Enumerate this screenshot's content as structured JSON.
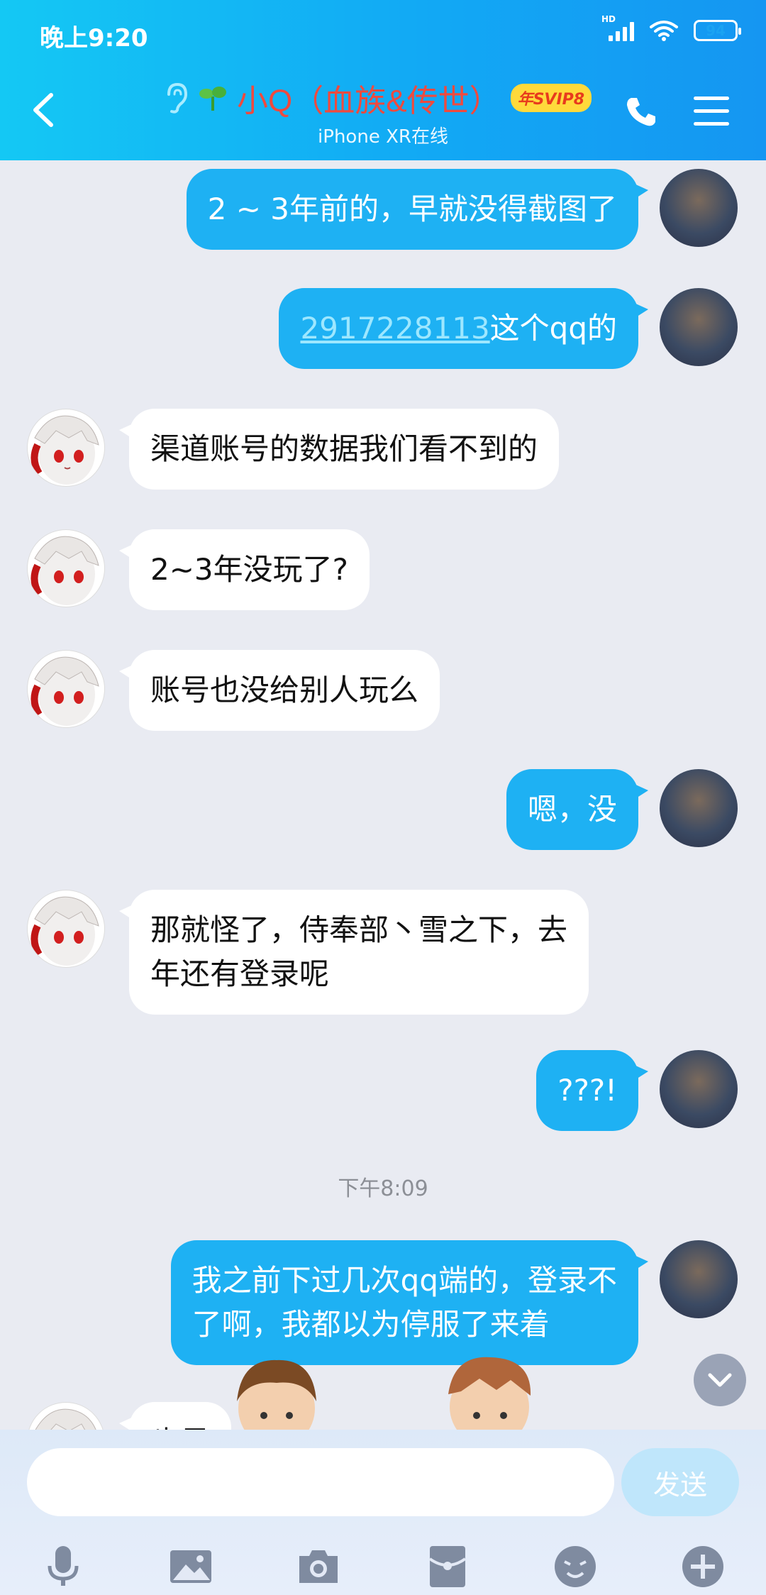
{
  "status_bar": {
    "time": "晚上9:20",
    "network": "HD",
    "battery": "94",
    "battery_level": 0.94
  },
  "header": {
    "contact_name": "小Q（血族&传世）",
    "badge": "年SVIP8",
    "subtitle": "iPhone XR在线"
  },
  "messages": [
    {
      "side": "out",
      "text": "2 ~ 3年前的，早就没得截图了"
    },
    {
      "side": "out",
      "link": "2917228113",
      "text": "这个qq的"
    },
    {
      "side": "in",
      "text": "渠道账号的数据我们看不到的"
    },
    {
      "side": "in",
      "text": "2~3年没玩了?"
    },
    {
      "side": "in",
      "text": "账号也没给别人玩么"
    },
    {
      "side": "out",
      "text": "嗯，没"
    },
    {
      "side": "in",
      "lines": [
        "那就怪了，侍奉部丶雪之下，去",
        "年还有登录呢"
      ]
    },
    {
      "side": "out",
      "text": "???!"
    },
    {
      "side": "out",
      "lines": [
        "我之前下过几次qq端的，登录不",
        "了啊，我都以为停服了来着"
      ]
    },
    {
      "side": "in",
      "text": "也是"
    }
  ],
  "timestamp": "下午8:09",
  "input": {
    "placeholder": "",
    "send_label": "发送"
  },
  "toolbar": [
    "microphone-icon",
    "image-icon",
    "camera-icon",
    "red-packet-icon",
    "emoji-icon",
    "plus-icon"
  ],
  "colors": {
    "header_start": "#14c8f4",
    "header_end": "#1596f2",
    "out_bubble": "#1eb1f3",
    "in_bubble": "#ffffff",
    "background": "#e9ebf2"
  }
}
